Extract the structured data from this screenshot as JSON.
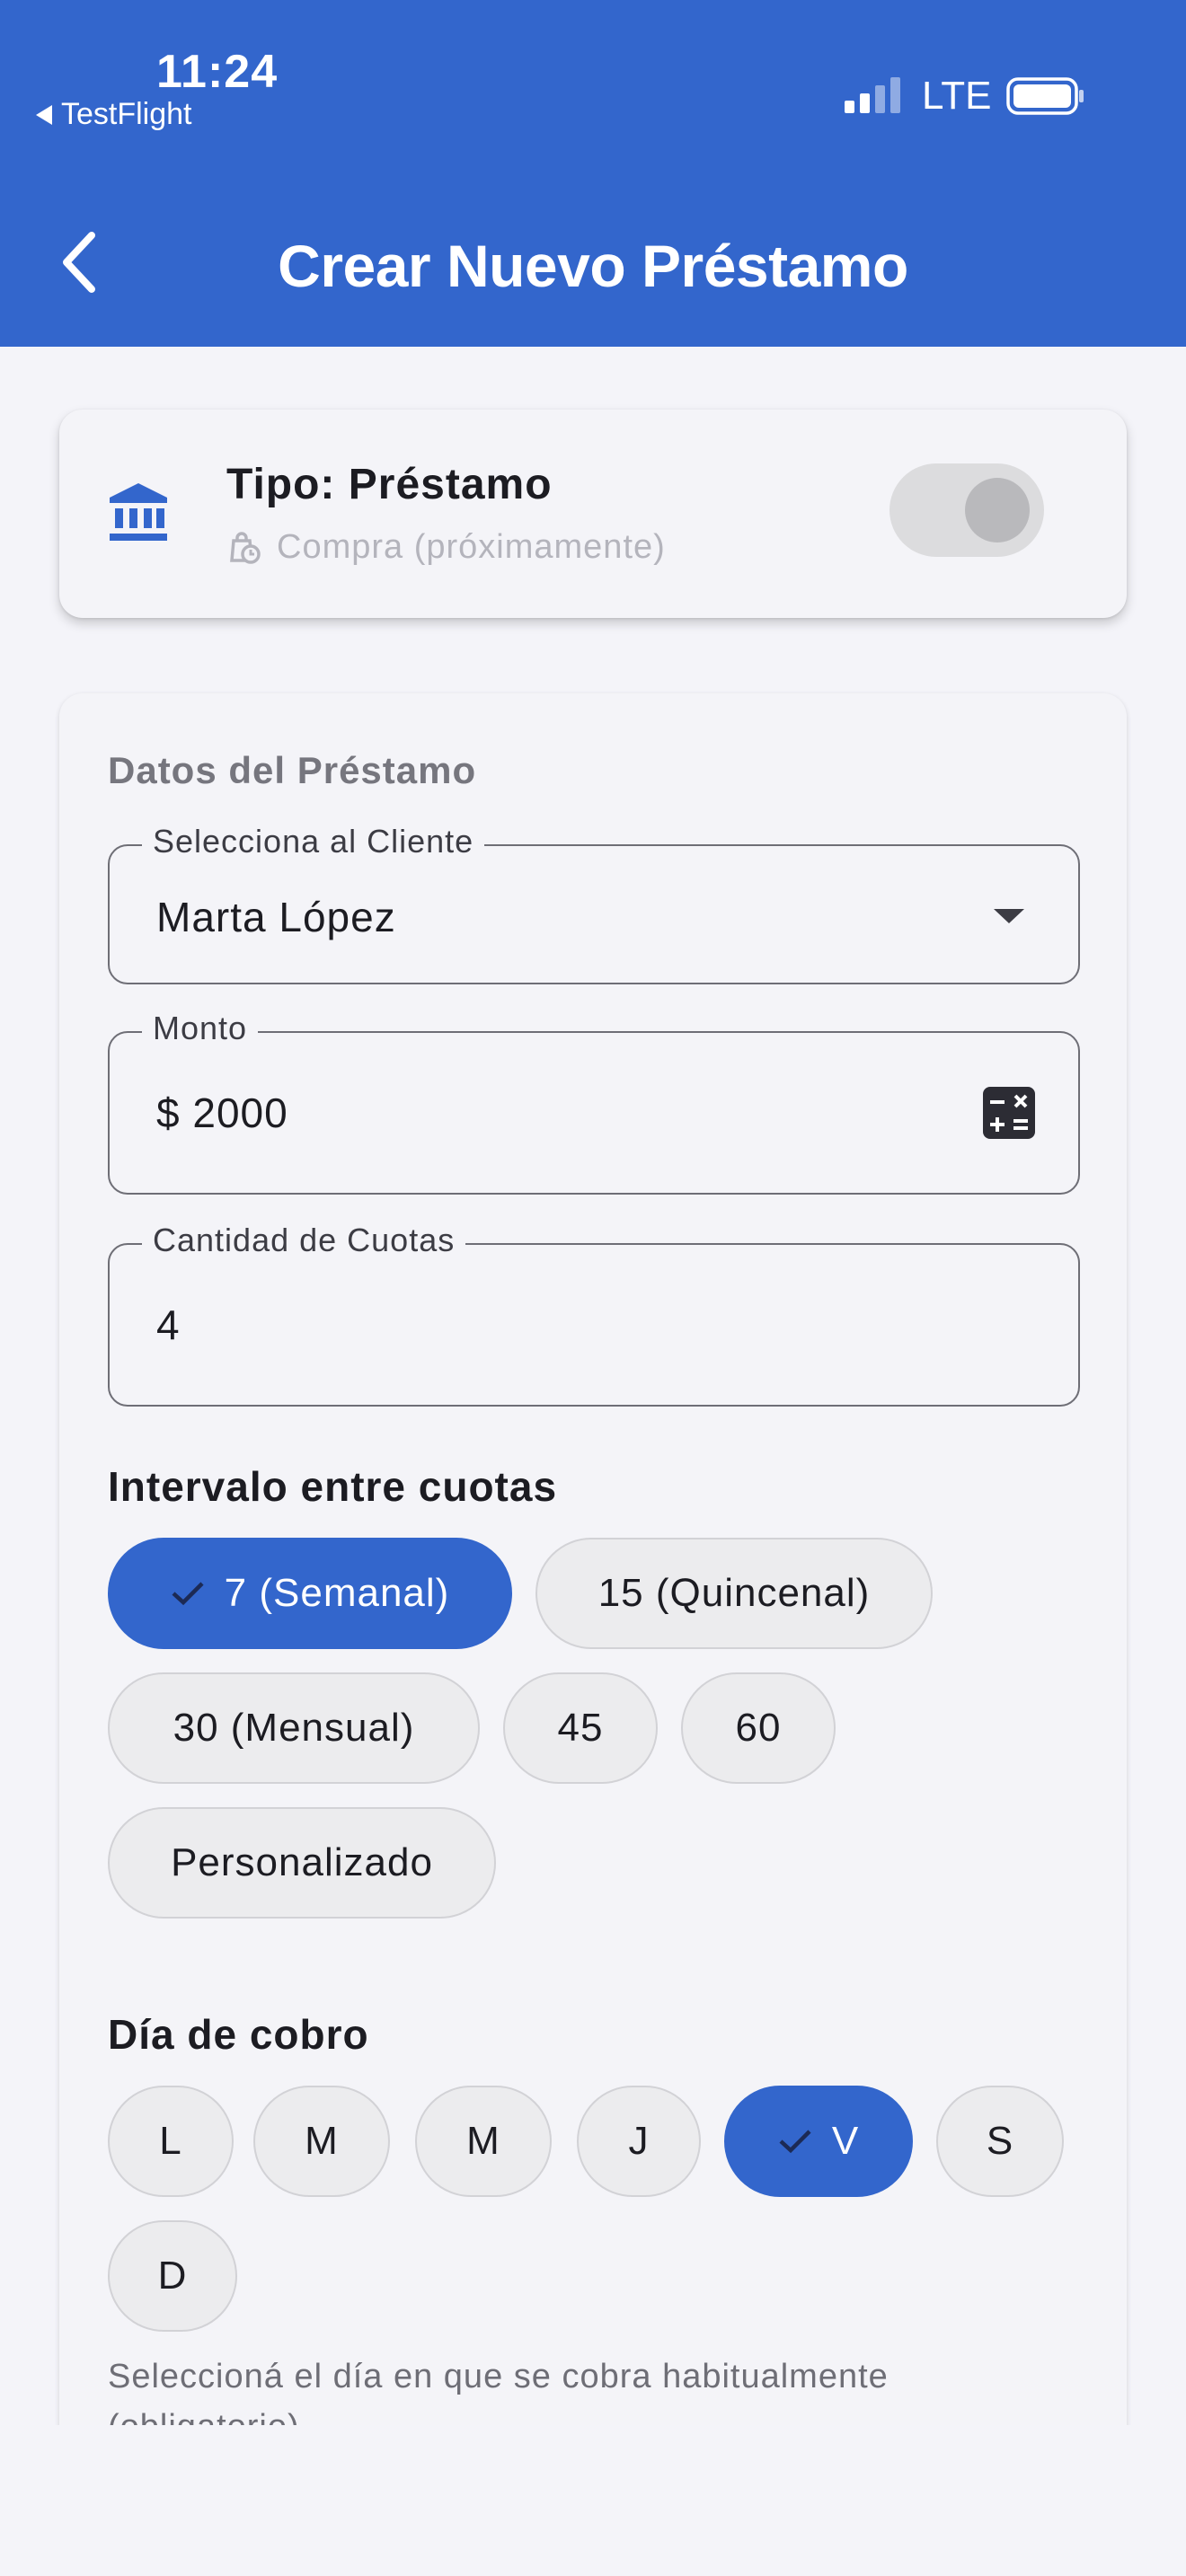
{
  "status_bar": {
    "time": "11:24",
    "back_app": "TestFlight",
    "network": "LTE"
  },
  "header": {
    "title": "Crear Nuevo Préstamo",
    "back_icon": "chevron-left-icon"
  },
  "type_card": {
    "icon": "bank-icon",
    "title": "Tipo: Préstamo",
    "subtitle": "Compra (próximamente)",
    "subtitle_icon": "shopping-bag-clock-icon",
    "toggle_on": false
  },
  "loan_form": {
    "section_title": "Datos del Préstamo",
    "client": {
      "label": "Selecciona al Cliente",
      "value": "Marta López"
    },
    "amount": {
      "label": "Monto",
      "value": "$ 2000"
    },
    "installments": {
      "label": "Cantidad de Cuotas",
      "value": "4"
    },
    "interval": {
      "title": "Intervalo entre cuotas",
      "options": [
        "7 (Semanal)",
        "15 (Quincenal)",
        "30 (Mensual)",
        "45",
        "60",
        "Personalizado"
      ],
      "selected": "7 (Semanal)"
    },
    "collection_day": {
      "title": "Día de cobro",
      "options": [
        "L",
        "M",
        "M",
        "J",
        "V",
        "S",
        "D"
      ],
      "selected": "V",
      "helper": "Seleccioná el día en que se cobra habitualmente (obligatorio)"
    }
  },
  "colors": {
    "primary": "#3366cc",
    "background": "#f4f4f9",
    "chip": "#ececee"
  }
}
